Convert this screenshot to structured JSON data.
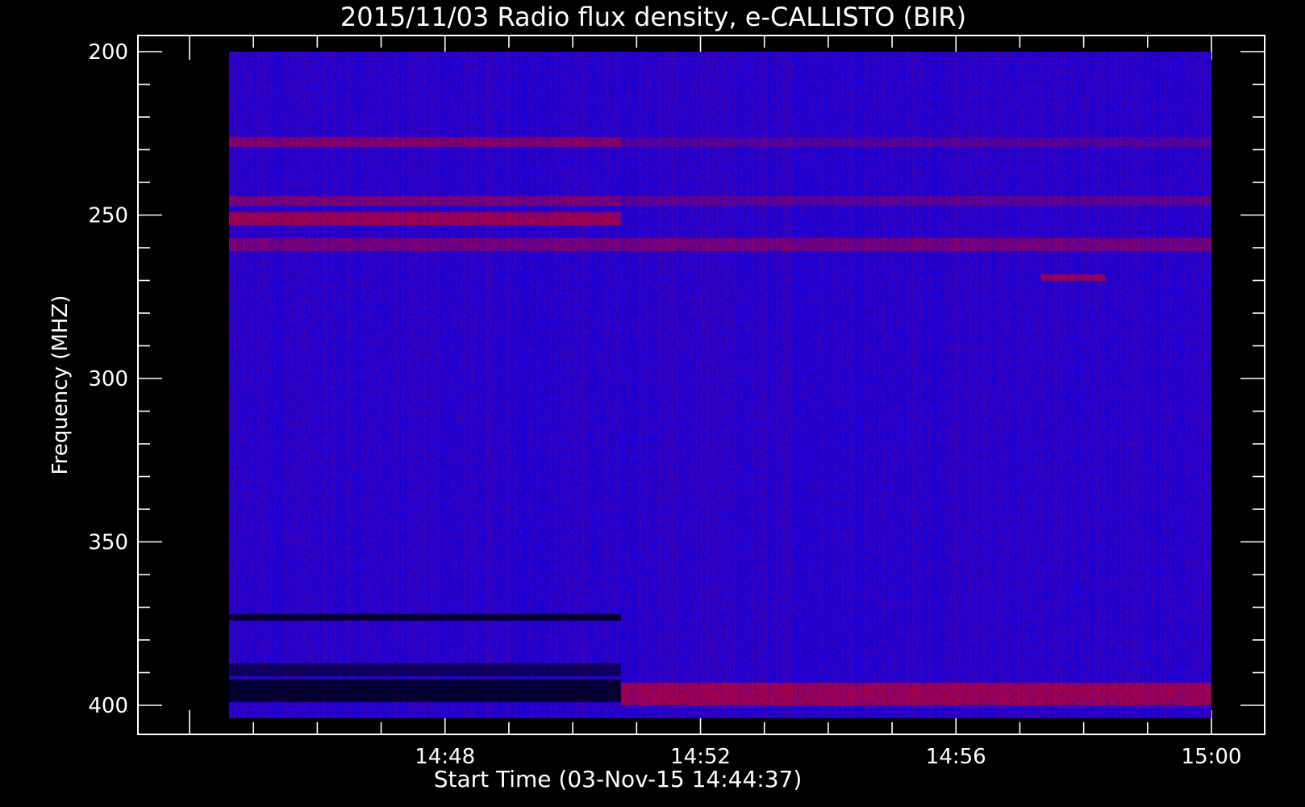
{
  "chart_data": {
    "type": "heatmap",
    "title": "2015/11/03  Radio flux density, e-CALLISTO (BIR)",
    "xlabel": "Start Time (03-Nov-15 14:44:37)",
    "ylabel": "Frequency (MHZ)",
    "x_ticks": [
      "14:48",
      "14:52",
      "14:56",
      "15:00"
    ],
    "y_ticks": [
      "200",
      "250",
      "300",
      "350",
      "400"
    ],
    "x_range": [
      "14:44:37",
      "15:00:00"
    ],
    "x_plot_range": [
      "14:44:00",
      "15:00:00"
    ],
    "ylim": [
      405,
      195
    ],
    "data_ylim": [
      200,
      404
    ],
    "y_inverted": true,
    "change_time": "14:50:45",
    "colors": {
      "background": "#0000e8",
      "high": "#b01010",
      "gap": "#000000",
      "axis": "#ffffff"
    },
    "bands": [
      {
        "f0": 226,
        "f1": 229,
        "t0": "14:44:37",
        "t1": "14:50:45",
        "level": 0.6
      },
      {
        "f0": 226,
        "f1": 229,
        "t0": "14:50:45",
        "t1": "15:00:00",
        "level": 0.3
      },
      {
        "f0": 244,
        "f1": 247,
        "t0": "14:44:37",
        "t1": "14:50:45",
        "level": 0.55
      },
      {
        "f0": 244,
        "f1": 247,
        "t0": "14:50:45",
        "t1": "15:00:00",
        "level": 0.35
      },
      {
        "f0": 249,
        "f1": 253,
        "t0": "14:44:37",
        "t1": "14:50:45",
        "level": 0.8
      },
      {
        "f0": 257,
        "f1": 261,
        "t0": "14:44:37",
        "t1": "15:00:00",
        "level": 0.5
      },
      {
        "f0": 268,
        "f1": 270,
        "t0": "14:57:20",
        "t1": "14:58:20",
        "level": 0.7
      },
      {
        "f0": 372,
        "f1": 374,
        "t0": "14:44:37",
        "t1": "14:50:45",
        "level": -1
      },
      {
        "f0": 387,
        "f1": 391,
        "t0": "14:44:37",
        "t1": "14:50:45",
        "level": -0.7
      },
      {
        "f0": 392,
        "f1": 399,
        "t0": "14:44:37",
        "t1": "14:50:45",
        "level": -1
      },
      {
        "f0": 393,
        "f1": 400,
        "t0": "14:50:45",
        "t1": "15:00:00",
        "level": 0.8
      }
    ]
  }
}
